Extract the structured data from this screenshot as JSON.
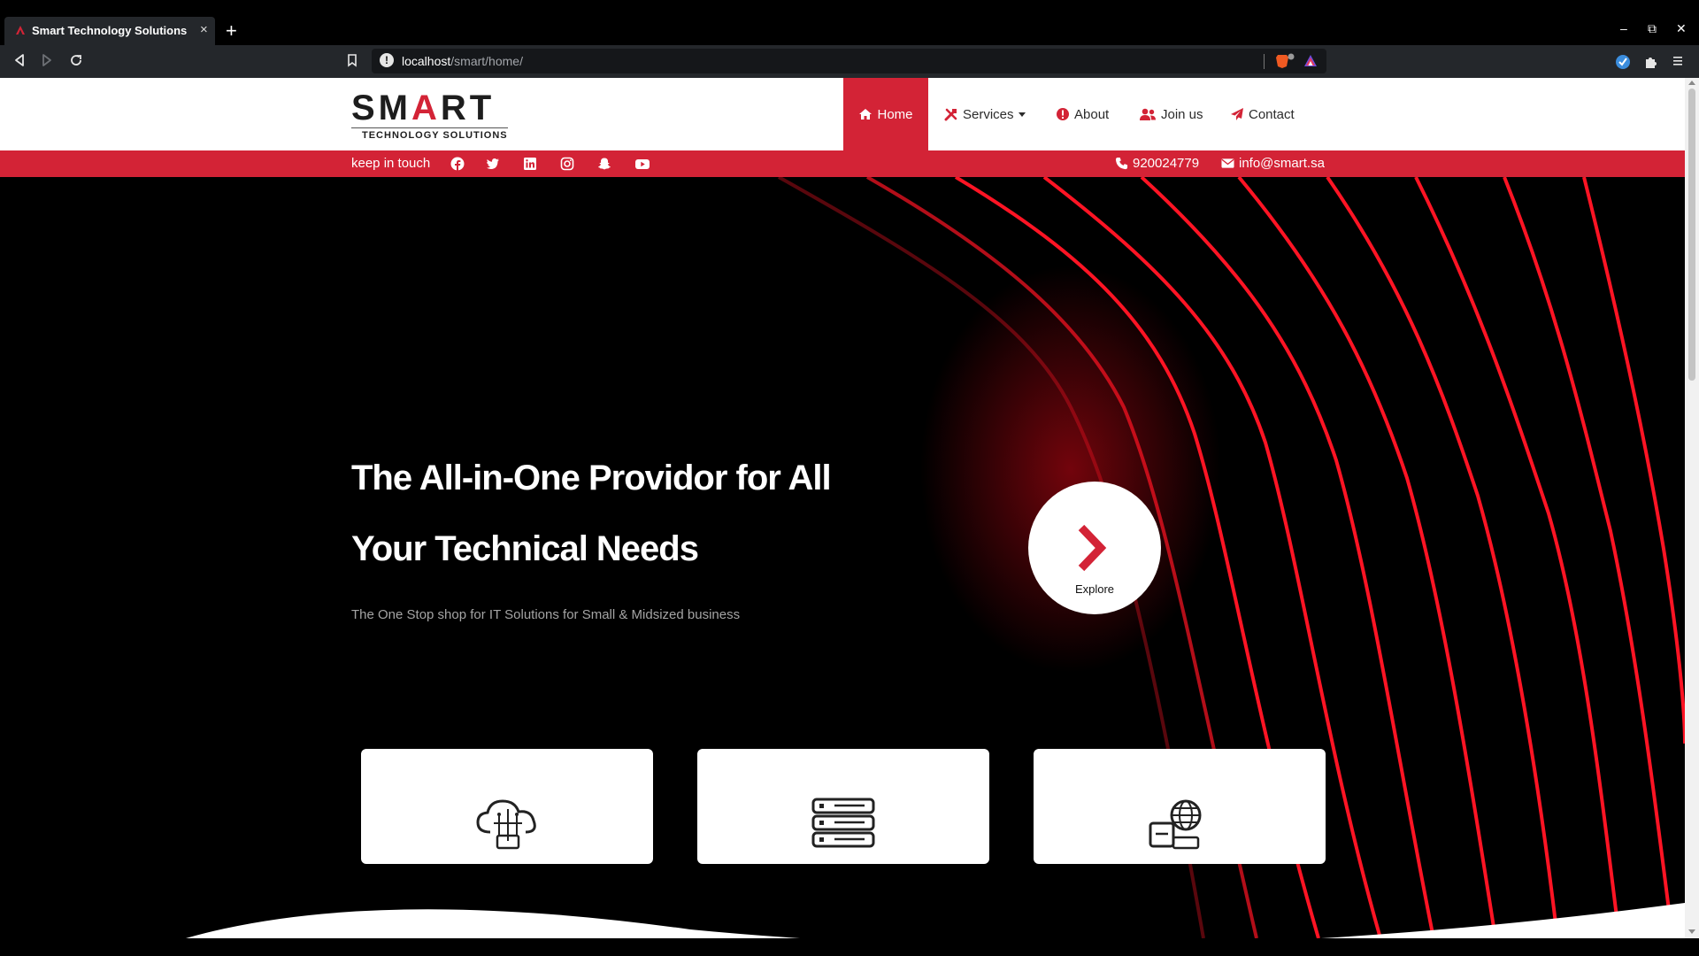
{
  "browser": {
    "tab_title": "Smart Technology Solutions",
    "tab_close": "×",
    "new_tab": "+",
    "url_host": "localhost",
    "url_path": "/smart/home/",
    "window_controls": {
      "minimize": "–",
      "restore": "⧉",
      "close": "✕"
    }
  },
  "site": {
    "logo": {
      "word_a": "SM",
      "word_b": "A",
      "word_c": "RT",
      "subtitle": "TECHNOLOGY SOLUTIONS"
    },
    "nav": [
      {
        "label": "Home",
        "icon": "home-icon"
      },
      {
        "label": "Services",
        "icon": "tools-icon"
      },
      {
        "label": "About",
        "icon": "info-circle-icon"
      },
      {
        "label": "Join us",
        "icon": "users-icon"
      },
      {
        "label": "Contact",
        "icon": "paper-plane-icon"
      }
    ],
    "topbar": {
      "keep_in_touch": "keep in touch",
      "social": [
        "facebook-icon",
        "twitter-icon",
        "linkedin-icon",
        "instagram-icon",
        "snapchat-icon",
        "youtube-icon"
      ],
      "phone": "920024779",
      "email": "info@smart.sa"
    },
    "hero": {
      "title": "The All-in-One Providor for All Your Technical Needs",
      "subtitle": "The One Stop shop for IT Solutions for Small & Midsized business",
      "explore_label": "Explore"
    },
    "cards": [
      "cloud-circuit-icon",
      "server-icon",
      "globe-network-icon"
    ]
  },
  "colors": {
    "brand_red": "#d32336",
    "chrome_dark": "#24272b",
    "hero_bg": "#000000"
  }
}
